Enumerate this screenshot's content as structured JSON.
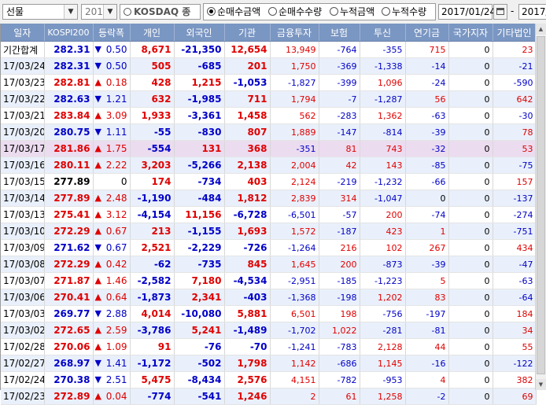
{
  "toolbar": {
    "market_select": "선물",
    "code_select": "201",
    "index_name": "KOSDAQ 종",
    "radios": [
      {
        "label": "순매수금액",
        "selected": true
      },
      {
        "label": "순매수수량",
        "selected": false
      },
      {
        "label": "누적금액",
        "selected": false
      },
      {
        "label": "누적수량",
        "selected": false
      }
    ],
    "start_date": "2017/01/24",
    "separator": "-",
    "end_date": "2017/"
  },
  "table": {
    "columns": [
      "일자",
      "KOSPI200",
      "등락폭",
      "개인",
      "외국인",
      "기관",
      "금융투자",
      "보험",
      "투신",
      "연기금",
      "국가지자",
      "기타법인"
    ],
    "rows": [
      {
        "date": "기간합계",
        "kospi": "282.31",
        "dir": "down",
        "chg": "0.50",
        "ind": "8,671",
        "for": "-21,350",
        "inst": "12,654",
        "fin": "13,949",
        "ins": "-764",
        "inv": "-355",
        "pen": "715",
        "gov": "0",
        "etc": "23"
      },
      {
        "date": "17/03/24",
        "kospi": "282.31",
        "dir": "down",
        "chg": "0.50",
        "ind": "505",
        "for": "-685",
        "inst": "201",
        "fin": "1,750",
        "ins": "-369",
        "inv": "-1,338",
        "pen": "-14",
        "gov": "0",
        "etc": "-21"
      },
      {
        "date": "17/03/23",
        "kospi": "282.81",
        "dir": "up",
        "chg": "0.18",
        "ind": "428",
        "for": "1,215",
        "inst": "-1,053",
        "fin": "-1,827",
        "ins": "-399",
        "inv": "1,096",
        "pen": "-24",
        "gov": "0",
        "etc": "-590"
      },
      {
        "date": "17/03/22",
        "kospi": "282.63",
        "dir": "down",
        "chg": "1.21",
        "ind": "632",
        "for": "-1,985",
        "inst": "711",
        "fin": "1,794",
        "ins": "-7",
        "inv": "-1,287",
        "pen": "56",
        "gov": "0",
        "etc": "642"
      },
      {
        "date": "17/03/21",
        "kospi": "283.84",
        "dir": "up",
        "chg": "3.09",
        "ind": "1,933",
        "for": "-3,361",
        "inst": "1,458",
        "fin": "562",
        "ins": "-283",
        "inv": "1,362",
        "pen": "-63",
        "gov": "0",
        "etc": "-30"
      },
      {
        "date": "17/03/20",
        "kospi": "280.75",
        "dir": "down",
        "chg": "1.11",
        "ind": "-55",
        "for": "-830",
        "inst": "807",
        "fin": "1,889",
        "ins": "-147",
        "inv": "-814",
        "pen": "-39",
        "gov": "0",
        "etc": "78"
      },
      {
        "date": "17/03/17",
        "kospi": "281.86",
        "dir": "up",
        "chg": "1.75",
        "ind": "-554",
        "for": "131",
        "inst": "368",
        "fin": "-351",
        "ins": "81",
        "inv": "743",
        "pen": "-32",
        "gov": "0",
        "etc": "53"
      },
      {
        "date": "17/03/16",
        "kospi": "280.11",
        "dir": "up",
        "chg": "2.22",
        "ind": "3,203",
        "for": "-5,266",
        "inst": "2,138",
        "fin": "2,004",
        "ins": "42",
        "inv": "143",
        "pen": "-85",
        "gov": "0",
        "etc": "-75"
      },
      {
        "date": "17/03/15",
        "kospi": "277.89",
        "dir": "none",
        "chg": "0",
        "ind": "174",
        "for": "-734",
        "inst": "403",
        "fin": "2,124",
        "ins": "-219",
        "inv": "-1,232",
        "pen": "-66",
        "gov": "0",
        "etc": "157"
      },
      {
        "date": "17/03/14",
        "kospi": "277.89",
        "dir": "up",
        "chg": "2.48",
        "ind": "-1,190",
        "for": "-484",
        "inst": "1,812",
        "fin": "2,839",
        "ins": "314",
        "inv": "-1,047",
        "pen": "0",
        "gov": "0",
        "etc": "-137"
      },
      {
        "date": "17/03/13",
        "kospi": "275.41",
        "dir": "up",
        "chg": "3.12",
        "ind": "-4,154",
        "for": "11,156",
        "inst": "-6,728",
        "fin": "-6,501",
        "ins": "-57",
        "inv": "200",
        "pen": "-74",
        "gov": "0",
        "etc": "-274"
      },
      {
        "date": "17/03/10",
        "kospi": "272.29",
        "dir": "up",
        "chg": "0.67",
        "ind": "213",
        "for": "-1,155",
        "inst": "1,693",
        "fin": "1,572",
        "ins": "-187",
        "inv": "423",
        "pen": "1",
        "gov": "0",
        "etc": "-751"
      },
      {
        "date": "17/03/09",
        "kospi": "271.62",
        "dir": "down",
        "chg": "0.67",
        "ind": "2,521",
        "for": "-2,229",
        "inst": "-726",
        "fin": "-1,264",
        "ins": "216",
        "inv": "102",
        "pen": "267",
        "gov": "0",
        "etc": "434"
      },
      {
        "date": "17/03/08",
        "kospi": "272.29",
        "dir": "up",
        "chg": "0.42",
        "ind": "-62",
        "for": "-735",
        "inst": "845",
        "fin": "1,645",
        "ins": "200",
        "inv": "-873",
        "pen": "-39",
        "gov": "0",
        "etc": "-47"
      },
      {
        "date": "17/03/07",
        "kospi": "271.87",
        "dir": "up",
        "chg": "1.46",
        "ind": "-2,582",
        "for": "7,180",
        "inst": "-4,534",
        "fin": "-2,951",
        "ins": "-185",
        "inv": "-1,223",
        "pen": "5",
        "gov": "0",
        "etc": "-63"
      },
      {
        "date": "17/03/06",
        "kospi": "270.41",
        "dir": "up",
        "chg": "0.64",
        "ind": "-1,873",
        "for": "2,341",
        "inst": "-403",
        "fin": "-1,368",
        "ins": "-198",
        "inv": "1,202",
        "pen": "83",
        "gov": "0",
        "etc": "-64"
      },
      {
        "date": "17/03/03",
        "kospi": "269.77",
        "dir": "down",
        "chg": "2.88",
        "ind": "4,014",
        "for": "-10,080",
        "inst": "5,881",
        "fin": "6,501",
        "ins": "198",
        "inv": "-756",
        "pen": "-197",
        "gov": "0",
        "etc": "184"
      },
      {
        "date": "17/03/02",
        "kospi": "272.65",
        "dir": "up",
        "chg": "2.59",
        "ind": "-3,786",
        "for": "5,241",
        "inst": "-1,489",
        "fin": "-1,702",
        "ins": "1,022",
        "inv": "-281",
        "pen": "-81",
        "gov": "0",
        "etc": "34"
      },
      {
        "date": "17/02/28",
        "kospi": "270.06",
        "dir": "up",
        "chg": "1.09",
        "ind": "91",
        "for": "-76",
        "inst": "-70",
        "fin": "-1,241",
        "ins": "-783",
        "inv": "2,128",
        "pen": "44",
        "gov": "0",
        "etc": "55"
      },
      {
        "date": "17/02/27",
        "kospi": "268.97",
        "dir": "down",
        "chg": "1.41",
        "ind": "-1,172",
        "for": "-502",
        "inst": "1,798",
        "fin": "1,142",
        "ins": "-686",
        "inv": "1,145",
        "pen": "-16",
        "gov": "0",
        "etc": "-122"
      },
      {
        "date": "17/02/24",
        "kospi": "270.38",
        "dir": "down",
        "chg": "2.51",
        "ind": "5,475",
        "for": "-8,434",
        "inst": "2,576",
        "fin": "4,151",
        "ins": "-782",
        "inv": "-953",
        "pen": "4",
        "gov": "0",
        "etc": "382"
      },
      {
        "date": "17/02/23",
        "kospi": "272.89",
        "dir": "up",
        "chg": "0.04",
        "ind": "-774",
        "for": "-541",
        "inst": "1,246",
        "fin": "2",
        "ins": "61",
        "inv": "1,258",
        "pen": "-2",
        "gov": "0",
        "etc": "69"
      }
    ]
  },
  "colors": {
    "up": "#e00000",
    "down": "#0000c8",
    "header_bg": "#7a96c2",
    "alt_row": "#e9f0fb",
    "selected_row": "#ecdcf0"
  },
  "icons": {
    "up": "▲",
    "down": "▼",
    "dropdown": "chevron-down-icon",
    "calendar": "calendar-icon"
  }
}
